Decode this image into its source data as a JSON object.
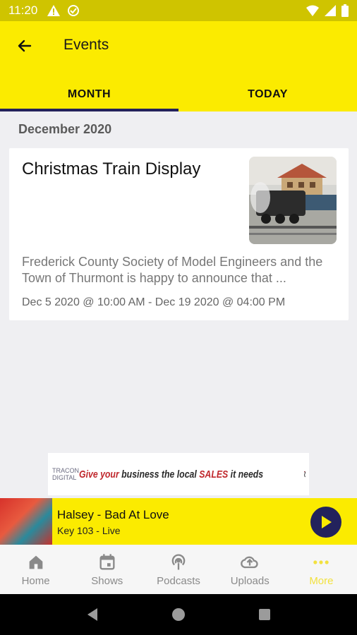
{
  "status_bar": {
    "time": "11:20"
  },
  "app_bar": {
    "title": "Events"
  },
  "tabs": [
    {
      "label": "MONTH",
      "active": true
    },
    {
      "label": "TODAY",
      "active": false
    }
  ],
  "section": {
    "header": "December 2020"
  },
  "event": {
    "title": "Christmas Train Display",
    "description": "Frederick County Society of Model Engineers and the Town of Thurmont is happy to announce that ...",
    "date_range": "Dec 5 2020 @ 10:00 AM - Dec 19 2020 @ 04:00 PM",
    "thumbnail_icon": "model-train-photo"
  },
  "ad": {
    "logo_text": "TRACON DIGITAL",
    "slogan_part1": "Give your",
    "slogan_part2": " business the local ",
    "slogan_part3": "SALES",
    "slogan_part4": " it needs"
  },
  "now_playing": {
    "title": "Halsey - Bad At Love",
    "subtitle": "Key 103 - Live"
  },
  "bottom_nav": [
    {
      "label": "Home",
      "icon": "home-icon",
      "active": false
    },
    {
      "label": "Shows",
      "icon": "calendar-icon",
      "active": false
    },
    {
      "label": "Podcasts",
      "icon": "podcast-icon",
      "active": false
    },
    {
      "label": "Uploads",
      "icon": "cloud-upload-icon",
      "active": false
    },
    {
      "label": "More",
      "icon": "more-dots-icon",
      "active": true
    }
  ],
  "colors": {
    "primary_yellow": "#fbeb00",
    "accent_navy": "#23225c",
    "status_yellow": "#cfc400"
  }
}
